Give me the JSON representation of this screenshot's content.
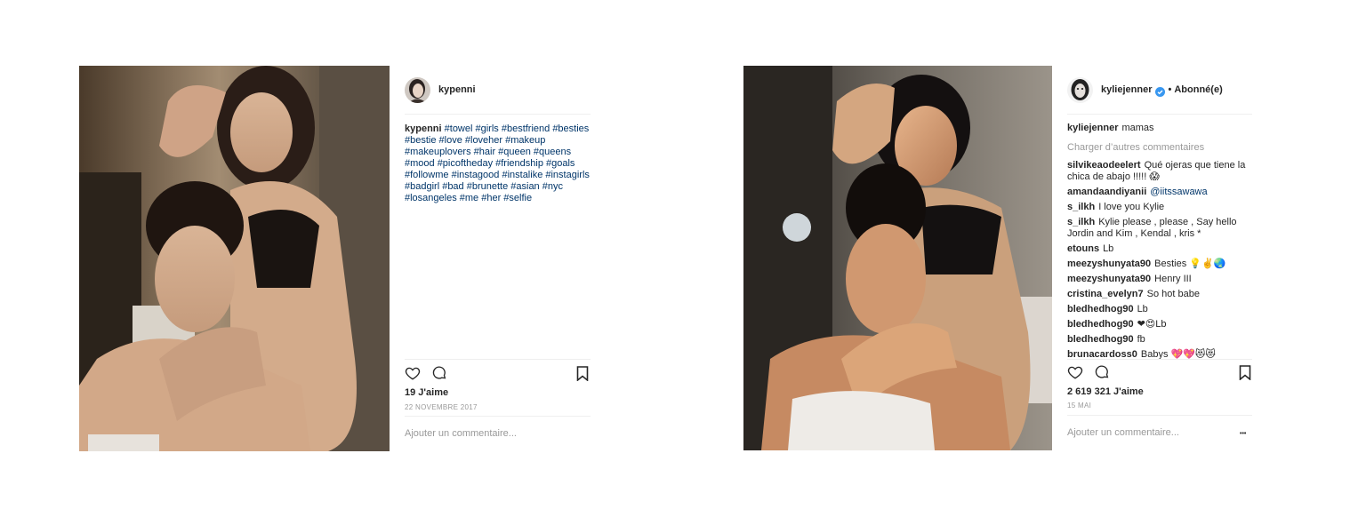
{
  "post1": {
    "username": "kypenni",
    "caption_user": "kypenni",
    "caption_tags": "#towel #girls #bestfriend #besties #bestie #love #loveher #makeup #makeuplovers #hair #queen #queens #mood #picoftheday #friendship #goals #followme #instagood #instalike #instagirls #badgirl #bad #brunette #asian #nyc #losangeles #me #her #selfie",
    "likes": "19 J'aime",
    "date": "22 NOVEMBRE 2017",
    "add_comment_placeholder": "Ajouter un commentaire...",
    "icons": [
      "heart-icon",
      "comment-icon",
      "bookmark-icon"
    ]
  },
  "post2": {
    "username": "kyliejenner",
    "follow_separator": "•",
    "follow_status": "Abonné(e)",
    "caption_user": "kyliejenner",
    "caption_text": "mamas",
    "load_more": "Charger d’autres commentaires",
    "comments": [
      {
        "user": "silvikeaodeelert",
        "text": "Qué ojeras que tiene la chica de abajo !!!!! 😱"
      },
      {
        "user": "amandaandiyanii",
        "text": "@iitssawawa"
      },
      {
        "user": "s_ilkh",
        "text": "I love you Kylie"
      },
      {
        "user": "s_ilkh",
        "text": "Kylie please , please , Say hello Jordin and Kim , Kendal , kris *"
      },
      {
        "user": "etouns",
        "text": "Lb"
      },
      {
        "user": "meezyshunyata90",
        "text": "Besties 💡✌️🌏"
      },
      {
        "user": "meezyshunyata90",
        "text": "Henry III"
      },
      {
        "user": "cristina_evelyn7",
        "text": "So hot babe"
      },
      {
        "user": "bledhedhog90",
        "text": "Lb"
      },
      {
        "user": "bledhedhog90",
        "text": "❤😍Lb"
      },
      {
        "user": "bledhedhog90",
        "text": "fb"
      },
      {
        "user": "brunacardoss0",
        "text": "Babys 💖💖😻😻"
      }
    ],
    "likes": "2 619 321 J'aime",
    "date": "15 MAI",
    "add_comment_placeholder": "Ajouter un commentaire...",
    "more_label": "•••",
    "icons": [
      "heart-icon",
      "comment-icon",
      "bookmark-icon",
      "verified-badge-icon",
      "more-options-icon"
    ]
  },
  "colors": {
    "text": "#262626",
    "muted": "#999999",
    "hashtag": "#003569",
    "divider": "#efefef",
    "verified": "#3897f0"
  }
}
